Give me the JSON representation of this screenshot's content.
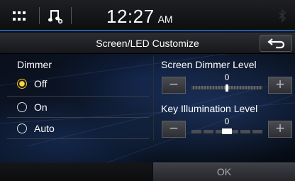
{
  "status_bar": {
    "time": "12:27",
    "ampm": "AM"
  },
  "title_bar": {
    "title": "Screen/LED Customize"
  },
  "dimmer": {
    "label": "Dimmer",
    "options": [
      {
        "label": "Off",
        "selected": true
      },
      {
        "label": "On",
        "selected": false
      },
      {
        "label": "Auto",
        "selected": false
      }
    ]
  },
  "screen_dimmer_level": {
    "label": "Screen Dimmer Level",
    "value": "0",
    "minus": "−",
    "plus": "+"
  },
  "key_illumination_level": {
    "label": "Key Illumination Level",
    "value": "0",
    "minus": "−",
    "plus": "+"
  },
  "footer": {
    "ok_label": "OK"
  },
  "colors": {
    "accent": "#2a5d9c",
    "selected_radio": "#f0c020"
  },
  "icons": [
    "grid-menu-icon",
    "music-note-icon",
    "bluetooth-icon",
    "back-arrow-icon"
  ]
}
